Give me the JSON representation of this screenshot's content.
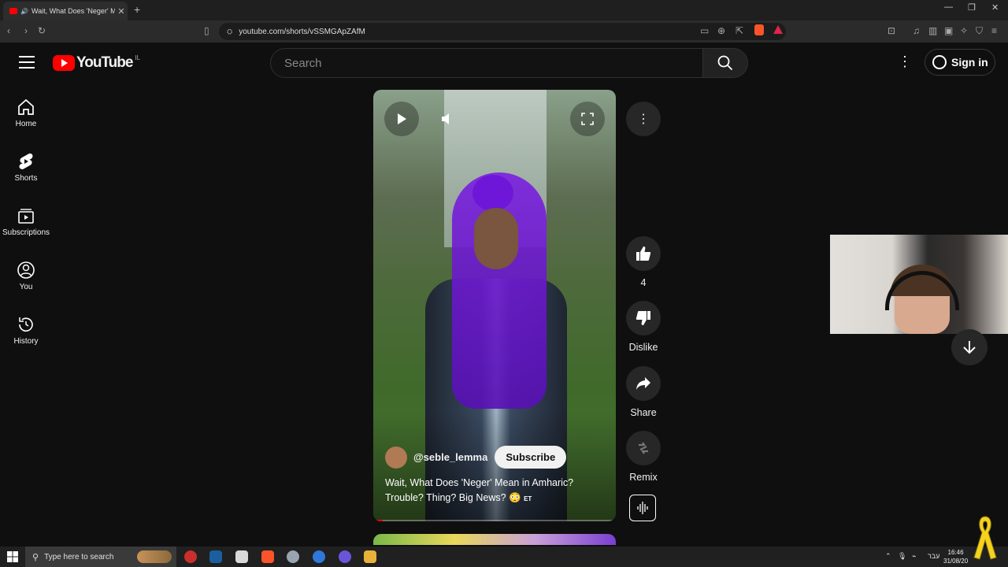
{
  "browser": {
    "tab_title": "Wait, What Does 'Neger' Mea",
    "tab_close": "✕",
    "new_tab": "+",
    "url": "youtube.com/shorts/vSSMGApZAfM",
    "window_controls": [
      "—",
      "❐",
      "✕"
    ]
  },
  "header": {
    "logo_text": "YouTube",
    "country_code": "IL",
    "search_placeholder": "Search",
    "sign_in_label": "Sign in"
  },
  "sidebar": {
    "items": [
      {
        "label": "Home",
        "icon": "home-icon"
      },
      {
        "label": "Shorts",
        "icon": "shorts-icon"
      },
      {
        "label": "Subscriptions",
        "icon": "subscriptions-icon"
      },
      {
        "label": "You",
        "icon": "you-icon"
      },
      {
        "label": "History",
        "icon": "history-icon"
      }
    ]
  },
  "short": {
    "channel": "@seble_lemma",
    "subscribe_label": "Subscribe",
    "caption_line1": "Wait, What Does 'Neger' Mean in Amharic?",
    "caption_line2": "Trouble? Thing? Big News? 😳",
    "caption_tag": "ET",
    "progress_fraction": 0.04
  },
  "actions": {
    "likes": "4",
    "dislike_label": "Dislike",
    "share_label": "Share",
    "remix_label": "Remix"
  },
  "taskbar": {
    "search_placeholder": "Type here to search",
    "language": "עבר",
    "time": "16:46",
    "date": "31/08/20"
  },
  "colors": {
    "youtube_red": "#ff0000",
    "background": "#0f0f0f",
    "hair_purple": "#6e17d8"
  }
}
